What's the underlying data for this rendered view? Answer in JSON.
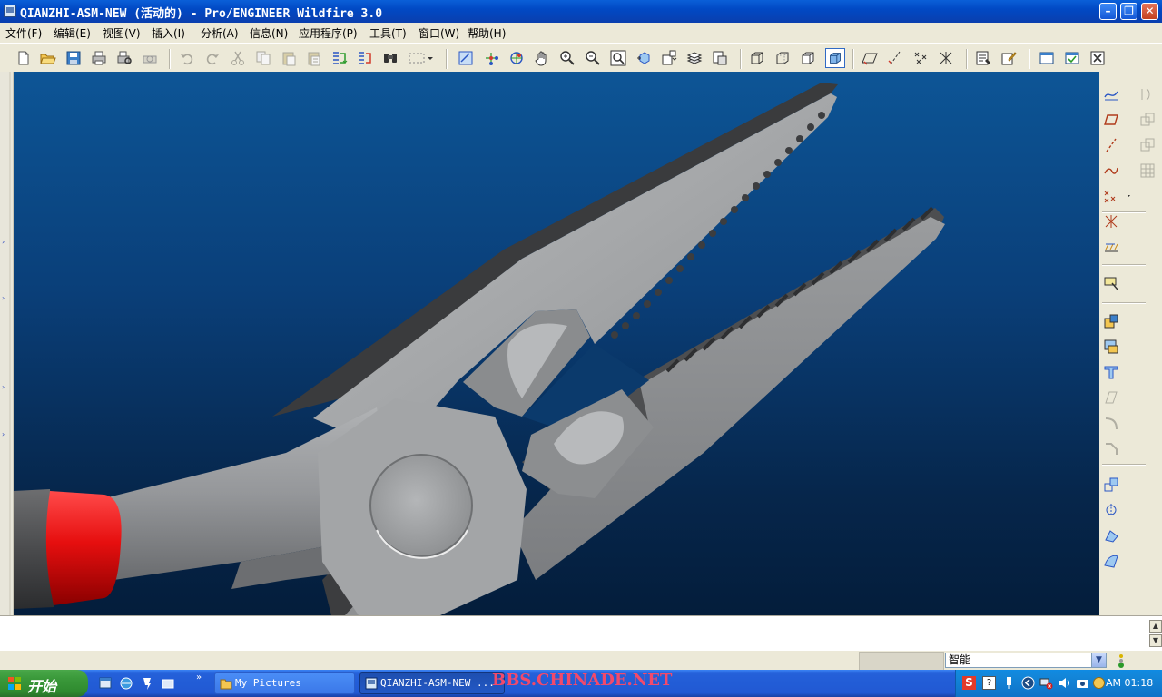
{
  "window": {
    "title": "QIANZHI-ASM-NEW (活动的) - Pro/ENGINEER Wildfire 3.0",
    "controls": [
      "minimize",
      "maximize",
      "close"
    ]
  },
  "menu": {
    "items": [
      "文件(F)",
      "编辑(E)",
      "视图(V)",
      "插入(I)",
      "分析(A)",
      "信息(N)",
      "应用程序(P)",
      "工具(T)",
      "窗口(W)",
      "帮助(H)"
    ]
  },
  "toolbar": {
    "icons": [
      "new-icon",
      "open-icon",
      "save-icon",
      "print-icon",
      "print-preview-icon",
      "print-3d-icon",
      "undo-icon",
      "redo-icon",
      "cut-icon",
      "copy-icon",
      "paste-icon",
      "paste-special-icon",
      "regenerate-icon",
      "regen-manager-icon",
      "find-icon",
      "select-box-icon",
      "repaint-icon",
      "spin-center-icon",
      "orient-icon",
      "pan-icon",
      "zoom-in-icon",
      "zoom-out-icon",
      "refit-icon",
      "reorient-icon",
      "saved-views-icon",
      "layers-icon",
      "view-manager-icon",
      "wireframe-icon",
      "hidden-line-icon",
      "no-hidden-icon",
      "shaded-icon",
      "datum-planes-toggle-icon",
      "datum-axes-toggle-icon",
      "datum-points-toggle-icon",
      "coord-sys-toggle-icon",
      "spin-center-toggle-icon",
      "annotations-toggle-icon",
      "context-help-icon",
      "window-activate-icon",
      "close-window-icon"
    ]
  },
  "right_toolbar": {
    "icons": [
      "datum-plane-icon",
      "datum-axis-icon",
      "datum-curve-icon",
      "datum-point-icon",
      "coordinate-system-icon",
      "analysis-feature-icon",
      "sketch-icon",
      "assemble-component-icon",
      "create-component-icon",
      "mirror-icon",
      "pattern-icon",
      "merge-icon",
      "cut-out-icon",
      "insert-mode-icon",
      "reference-icon",
      "cable-icon"
    ]
  },
  "status": {
    "filter_label": "智能"
  },
  "taskbar": {
    "start_label": "开始",
    "tasks": [
      {
        "label": "My Pictures"
      },
      {
        "label": "QIANZHI-ASM-NEW ..."
      }
    ],
    "watermark": "BBS.CHINADE.NET",
    "clock": "AM 01:18"
  },
  "colors": {
    "viewport_top": "#0d5596",
    "viewport_bottom": "#041d3b",
    "plier_metal": "#a9abad",
    "handle_grip": "#e61c1c",
    "titlebar": "#0149c4"
  }
}
